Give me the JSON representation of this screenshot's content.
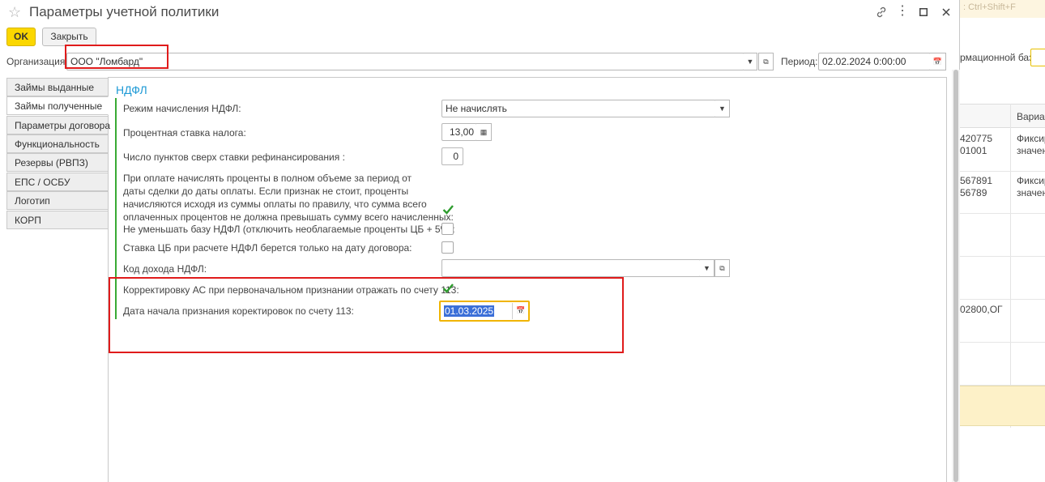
{
  "window": {
    "title": "Параметры учетной политики"
  },
  "toolbar": {
    "ok_label": "OK",
    "close_label": "Закрыть"
  },
  "header": {
    "organization_label": "Организация:",
    "organization_value": "ООО \"Ломбард\"",
    "period_label": "Период:",
    "period_value": "02.02.2024  0:00:00"
  },
  "tabs": [
    {
      "label": "Займы выданные",
      "active": false
    },
    {
      "label": "Займы полученные",
      "active": true
    },
    {
      "label": "Параметры договора",
      "active": false
    },
    {
      "label": "Функциональность",
      "active": false
    },
    {
      "label": "Резервы (РВПЗ)",
      "active": false
    },
    {
      "label": "ЕПС / ОСБУ",
      "active": false
    },
    {
      "label": "Логотип",
      "active": false
    },
    {
      "label": "КОРП",
      "active": false
    }
  ],
  "section": {
    "title": "НДФЛ",
    "accrual_mode_label": "Режим начисления НДФЛ:",
    "accrual_mode_value": "Не начислять",
    "tax_rate_label": "Процентная ставка налога:",
    "tax_rate_value": "13,00",
    "points_label": "Число пунктов сверх ставки рефинансирования :",
    "points_value": "0",
    "full_interest_label_lines": [
      "При оплате начислять проценты в полном объеме за период от",
      "даты сделки до даты оплаты. Если признак не стоит, проценты",
      "начисляются исходя из суммы оплаты по правилу, что сумма всего",
      "оплаченных процентов не должна превышать сумму всего начисленных:"
    ],
    "full_interest_checked": true,
    "no_reduce_label": "Не уменьшать базу НДФЛ (отключить необлагаемые проценты ЦБ + 5%):",
    "no_reduce_checked": false,
    "cb_rate_label": "Ставка ЦБ при расчете НДФЛ берется только на дату договора:",
    "cb_rate_checked": false,
    "income_code_label": "Код дохода НДФЛ:",
    "income_code_value": "",
    "correction_label": "Корректировку АС при первоначальном признании отражать по счету 113:",
    "correction_checked": true,
    "correction_date_label": "Дата начала признания коректировок по счету 113:",
    "correction_date_value": "01.03.2025"
  },
  "background_window": {
    "search_hint": ": Ctrl+Shift+F",
    "base_label": "рмационной базы:",
    "column_header": "Вариан",
    "rows": [
      {
        "code_lines": [
          "420775",
          "01001"
        ],
        "variant_lines": [
          "Фиксир",
          "значен"
        ]
      },
      {
        "code_lines": [
          "567891",
          "56789"
        ],
        "variant_lines": [
          "Фиксир",
          "значен"
        ]
      },
      {
        "code_lines": [
          "02800,ОГ"
        ],
        "variant_lines": []
      }
    ]
  },
  "colors": {
    "accent_yellow": "#fbd700",
    "section_title": "#1e9ad6",
    "group_bar": "#3aaa35",
    "highlight_red": "#e01b1b",
    "date_focus": "#f0b400",
    "selection": "#3b6fd8"
  },
  "icons": {
    "favorite": "star-icon",
    "link": "link-icon",
    "more": "more-icon",
    "maximize": "maximize-icon",
    "close": "close-icon",
    "dropdown": "chevron-down-icon",
    "open": "open-icon",
    "calendar": "calendar-icon",
    "check": "check-icon"
  }
}
